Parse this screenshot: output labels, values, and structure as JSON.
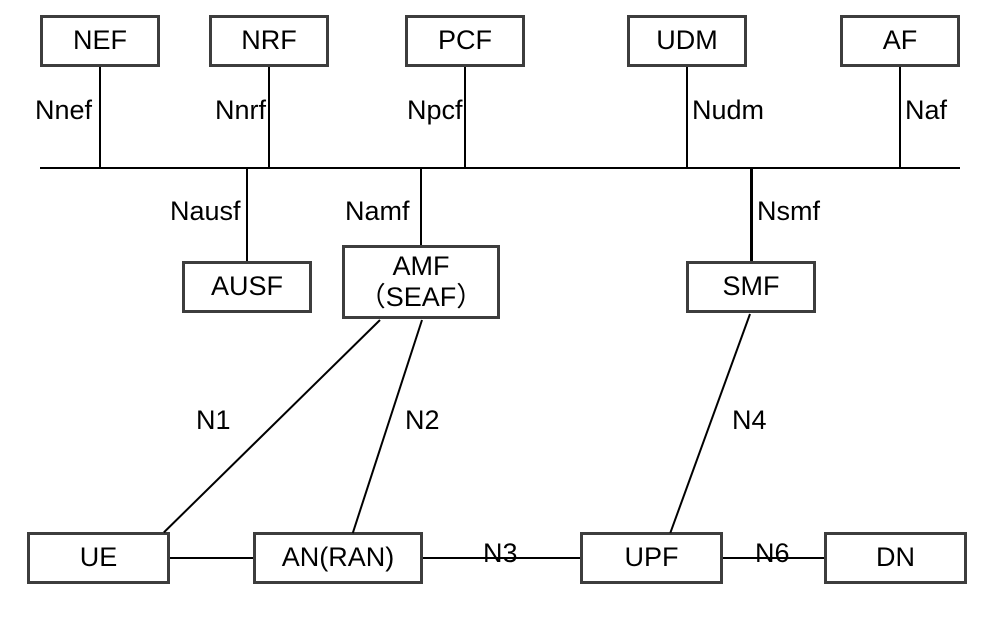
{
  "nodes": {
    "nef": "NEF",
    "nrf": "NRF",
    "pcf": "PCF",
    "udm": "UDM",
    "af": "AF",
    "ausf": "AUSF",
    "amf": "AMF\n（SEAF）",
    "smf": "SMF",
    "ue": "UE",
    "anran": "AN(RAN)",
    "upf": "UPF",
    "dn": "DN"
  },
  "labels": {
    "nnef": "Nnef",
    "nnrf": "Nnrf",
    "npcf": "Npcf",
    "nudm": "Nudm",
    "naf": "Naf",
    "nausf": "Nausf",
    "namf": "Namf",
    "nsmf": "Nsmf",
    "n1": "N1",
    "n2": "N2",
    "n3": "N3",
    "n4": "N4",
    "n6": "N6"
  }
}
